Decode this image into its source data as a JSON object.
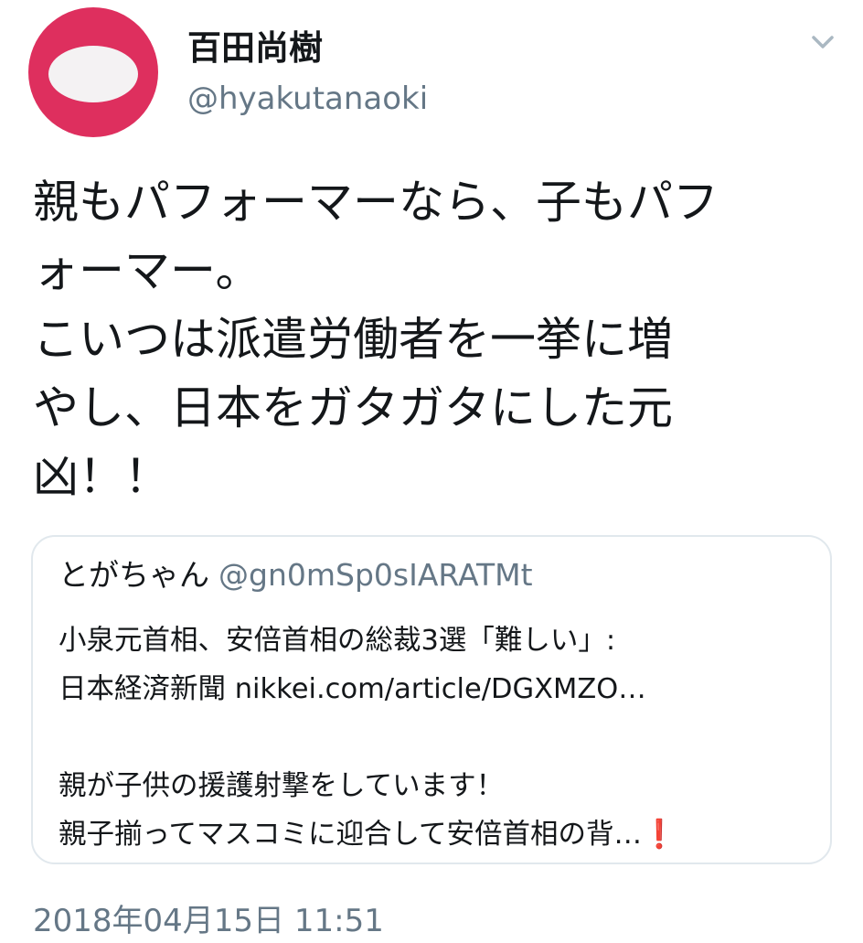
{
  "tweet": {
    "author": {
      "display_name": "百田尚樹",
      "handle": "@hyakutanaoki",
      "avatar_color": "#de2f5e"
    },
    "menu_icon": "chevron-down-icon",
    "text": "親もパフォーマーなら、子もパフ\nォーマー。\nこいつは派遣労働者を一挙に増\nやし、日本をガタガタにした元\n凶！！",
    "quoted": {
      "display_name": "とがちゃん",
      "handle": "@gn0mSp0sIARATMt",
      "text": "小泉元首相、安倍首相の総裁3選「難しい」:\n日本経済新聞 nikkei.com/article/DGXMZO…\n\n親が子供の援護射撃をしています！\n親子揃ってマスコミに迎合して安倍首相の背…",
      "trailing_emoji": "❗"
    },
    "timestamp": "2018年04月15日 11:51"
  },
  "colors": {
    "text_primary": "#14171a",
    "text_secondary": "#657786",
    "border": "#e1e8ed",
    "emoji_red": "#e0143c"
  }
}
